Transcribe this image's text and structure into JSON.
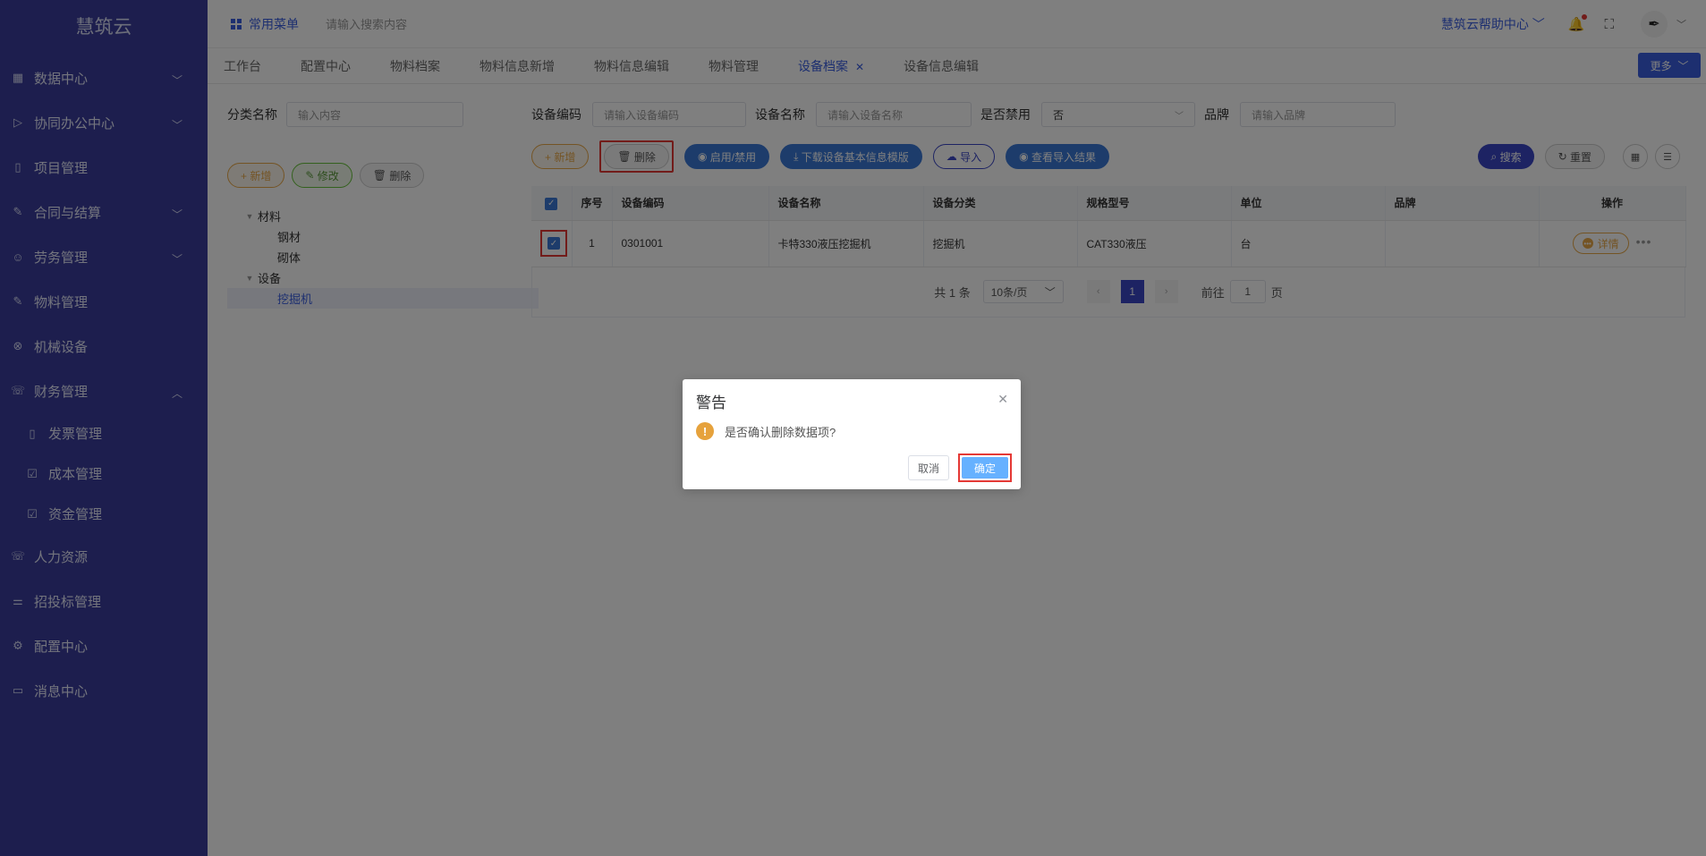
{
  "app": {
    "logo": "慧筑云"
  },
  "sidebar": {
    "items": [
      {
        "label": "数据中心",
        "icon": "grid-icon",
        "chevron": "down"
      },
      {
        "label": "协同办公中心",
        "icon": "send-icon",
        "chevron": "down"
      },
      {
        "label": "项目管理",
        "icon": "book-icon"
      },
      {
        "label": "合同与结算",
        "icon": "edit-icon",
        "chevron": "down"
      },
      {
        "label": "劳务管理",
        "icon": "user-icon",
        "chevron": "down"
      },
      {
        "label": "物料管理",
        "icon": "edit-icon"
      },
      {
        "label": "机械设备",
        "icon": "cross-circle-icon"
      },
      {
        "label": "财务管理",
        "icon": "phone-icon",
        "chevron": "up"
      }
    ],
    "subitems": [
      {
        "label": "发票管理",
        "icon": "book-icon"
      },
      {
        "label": "成本管理",
        "icon": "check-square-icon"
      },
      {
        "label": "资金管理",
        "icon": "check-square-icon"
      }
    ],
    "items_after": [
      {
        "label": "人力资源",
        "icon": "phone-icon"
      },
      {
        "label": "招投标管理",
        "icon": "sliders-icon"
      },
      {
        "label": "配置中心",
        "icon": "gear-icon"
      },
      {
        "label": "消息中心",
        "icon": "message-icon"
      }
    ]
  },
  "topbar": {
    "quick_menu": "常用菜单",
    "search_placeholder": "请输入搜索内容",
    "help_center": "慧筑云帮助中心"
  },
  "tabs": {
    "items": [
      "工作台",
      "配置中心",
      "物料档案",
      "物料信息新增",
      "物料信息编辑",
      "物料管理",
      "设备档案",
      "设备信息编辑"
    ],
    "active_index": 6,
    "more": "更多"
  },
  "left_panel": {
    "filter_label": "分类名称",
    "filter_placeholder": "输入内容",
    "buttons": {
      "add": "+ 新增",
      "edit": "修改",
      "delete": "删除"
    },
    "tree": {
      "materials": "材料",
      "steel": "钢材",
      "masonry": "砌体",
      "equipment": "设备",
      "excavator": "挖掘机"
    }
  },
  "search": {
    "code_label": "设备编码",
    "code_placeholder": "请输入设备编码",
    "name_label": "设备名称",
    "name_placeholder": "请输入设备名称",
    "disabled_label": "是否禁用",
    "disabled_value": "否",
    "brand_label": "品牌",
    "brand_placeholder": "请输入品牌"
  },
  "actions": {
    "add": "+ 新增",
    "delete": "删除",
    "toggle": "启用/禁用",
    "download": "下载设备基本信息模版",
    "import": "导入",
    "view_import": "查看导入结果",
    "search": "搜索",
    "reset": "重置"
  },
  "table": {
    "headers": [
      "序号",
      "设备编码",
      "设备名称",
      "设备分类",
      "规格型号",
      "单位",
      "品牌",
      "操作"
    ],
    "rows": [
      {
        "index": "1",
        "code": "0301001",
        "name": "卡特330液压挖掘机",
        "category": "挖掘机",
        "spec": "CAT330液压",
        "unit": "台",
        "brand": "",
        "detail": "详情"
      }
    ]
  },
  "pager": {
    "total": "共 1 条",
    "size": "10条/页",
    "page": "1",
    "goto_label": "前往",
    "goto_value": "1",
    "goto_suffix": "页"
  },
  "dialog": {
    "title": "警告",
    "message": "是否确认删除数据项?",
    "cancel": "取消",
    "confirm": "确定"
  },
  "colors": {
    "sidebar": "#3a3d9c",
    "primary": "#3b5fe0",
    "warning": "#e6a23c",
    "highlight": "#e53935"
  }
}
